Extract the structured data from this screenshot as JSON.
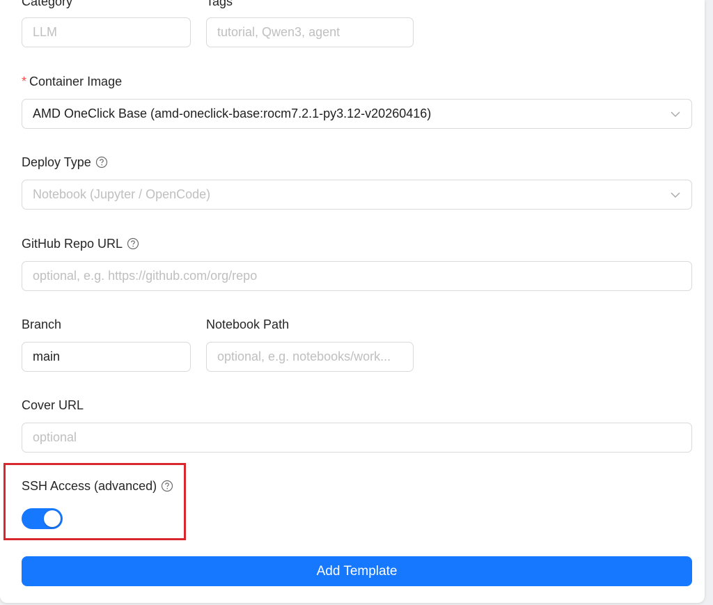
{
  "form": {
    "category": {
      "label": "Category",
      "placeholder": "LLM"
    },
    "tags": {
      "label": "Tags",
      "placeholder": "tutorial, Qwen3, agent"
    },
    "container_image": {
      "required_mark": "*",
      "label": "Container Image",
      "value": "AMD OneClick Base (amd-oneclick-base:rocm7.2.1-py3.12-v20260416)"
    },
    "deploy_type": {
      "label": "Deploy Type",
      "placeholder": "Notebook (Jupyter / OpenCode)"
    },
    "github_repo_url": {
      "label": "GitHub Repo URL",
      "placeholder": "optional, e.g. https://github.com/org/repo"
    },
    "branch": {
      "label": "Branch",
      "value": "main"
    },
    "notebook_path": {
      "label": "Notebook Path",
      "placeholder": "optional, e.g. notebooks/work..."
    },
    "cover_url": {
      "label": "Cover URL",
      "placeholder": "optional"
    },
    "ssh_access": {
      "label": "SSH Access (advanced)",
      "enabled": true
    },
    "submit_label": "Add Template"
  },
  "icons": {
    "help": "question-circle-icon",
    "dropdown": "chevron-down-icon"
  },
  "colors": {
    "primary": "#1677ff",
    "required": "#ff4d4f",
    "highlight_box": "#d9272e",
    "placeholder": "#bfbfbf",
    "border": "#d9d9d9"
  }
}
